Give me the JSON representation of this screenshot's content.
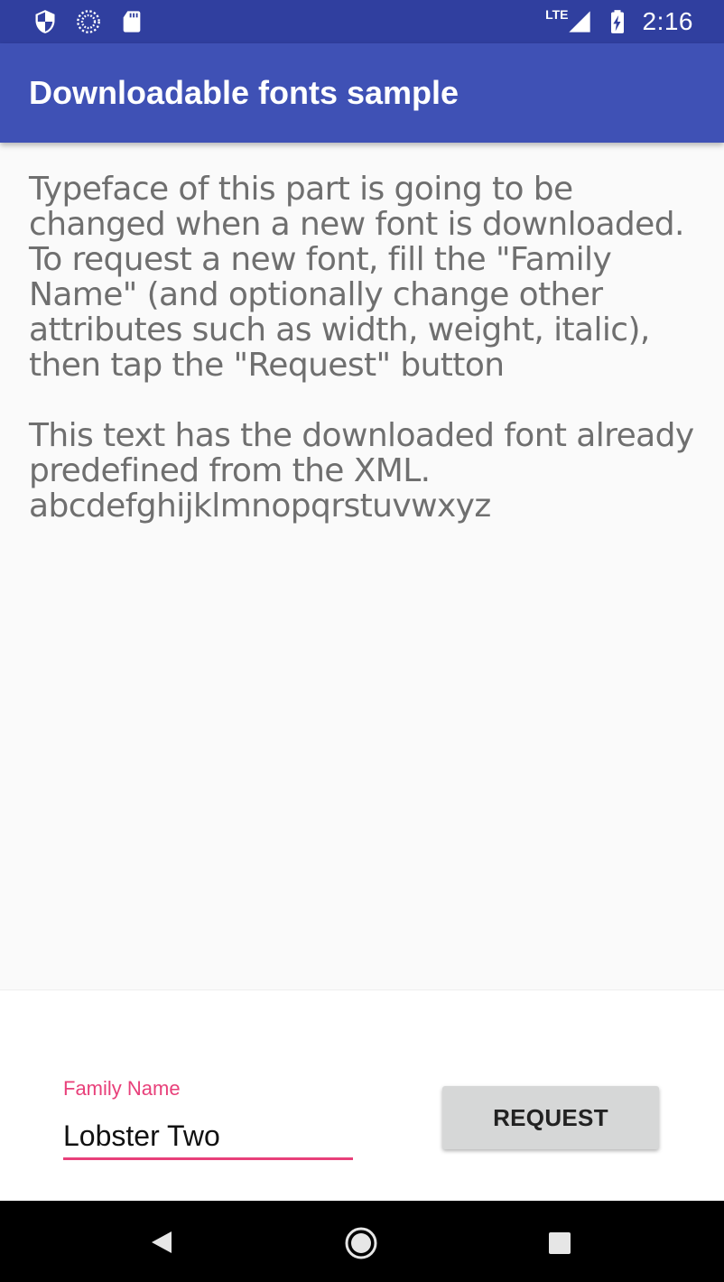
{
  "status_bar": {
    "icons_left": [
      "shield-icon",
      "sync-icon",
      "sd-card-icon"
    ],
    "network_label": "LTE",
    "icons_right": [
      "signal-icon",
      "battery-charging-icon"
    ],
    "time": "2:16"
  },
  "app_bar": {
    "title": "Downloadable fonts sample"
  },
  "content": {
    "paragraph1": "Typeface of this part is going to be changed when a new font is downloaded. To request a new font, fill the \"Family Name\" (and optionally change other attributes such as width, weight, italic), then tap the \"Request\" button",
    "paragraph2_line1": "This text has the downloaded font already predefined from the XML.",
    "paragraph2_line2": "abcdefghijklmnopqrstuvwxyz"
  },
  "form": {
    "family_name_label": "Family Name",
    "family_name_value": "Lobster Two",
    "request_button_label": "REQUEST"
  },
  "nav_bar": {
    "buttons": [
      "back-icon",
      "home-icon",
      "recents-icon"
    ]
  },
  "colors": {
    "status_bar": "#303f9f",
    "app_bar": "#3f51b5",
    "accent": "#e8407a",
    "button_bg": "#d6d7d7"
  }
}
